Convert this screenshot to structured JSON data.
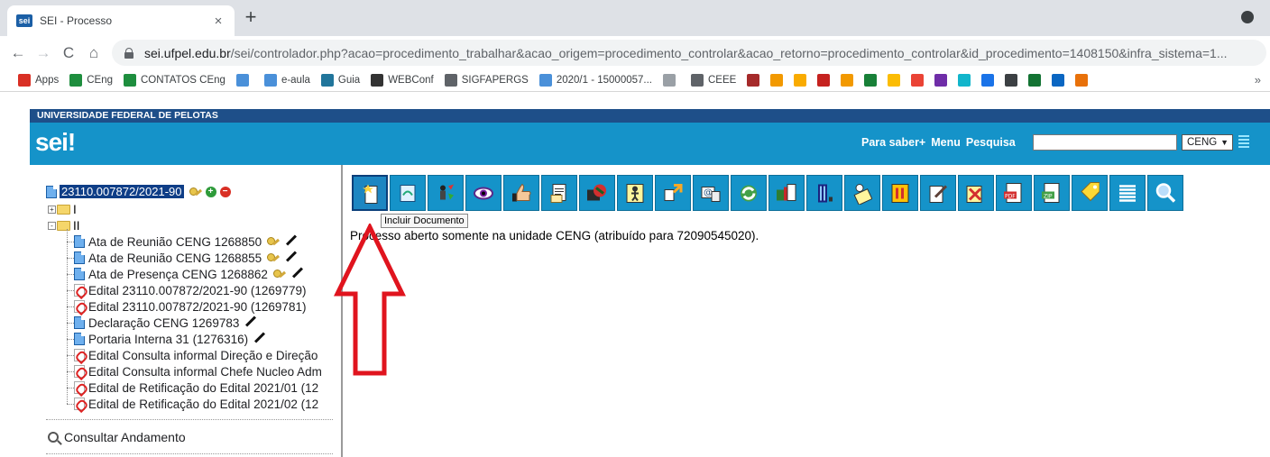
{
  "browser": {
    "tab_title": "SEI - Processo",
    "tab_close": "×",
    "new_tab": "+",
    "url_host": "sei.ufpel.edu.br",
    "url_path": "/sei/controlador.php?acao=procedimento_trabalhar&acao_origem=procedimento_controlar&acao_retorno=procedimento_controlar&id_procedimento=1408150&infra_sistema=1...",
    "nav": {
      "back": "←",
      "forward": "→",
      "reload": "C",
      "home": "⌂"
    },
    "bookmarks": [
      {
        "label": "Apps",
        "icon": "apps-grid-icon",
        "color": "#d93025"
      },
      {
        "label": "CEng",
        "icon": "green-plus-icon",
        "color": "#1e8e3e"
      },
      {
        "label": "CONTATOS CEng",
        "icon": "green-plus-icon",
        "color": "#1e8e3e"
      },
      {
        "label": "",
        "icon": "sei-gear-icon",
        "color": "#4a90d9"
      },
      {
        "label": "e-aula",
        "icon": "sei-gear-icon",
        "color": "#4a90d9"
      },
      {
        "label": "Guia",
        "icon": "wordpress-icon",
        "color": "#21759b"
      },
      {
        "label": "WEBConf",
        "icon": "webconf-icon",
        "color": "#333333"
      },
      {
        "label": "SIGFAPERGS",
        "icon": "globe-icon",
        "color": "#5f6368"
      },
      {
        "label": "2020/1 - 15000057...",
        "icon": "sei-gear-icon",
        "color": "#4a90d9"
      },
      {
        "label": "",
        "icon": "nbr-icon",
        "color": "#9aa0a6"
      },
      {
        "label": "CEEE",
        "icon": "globe-icon",
        "color": "#5f6368"
      }
    ],
    "bookmark_icon_only": [
      "#a52a2a",
      "#f29900",
      "#f9ab00",
      "#c5221f",
      "#f29900",
      "#188038",
      "#fbbc04",
      "#ea4335",
      "#6f2da8",
      "#12b5cb",
      "#1a73e8",
      "#3c4043",
      "#137333",
      "#0a66c2",
      "#e8710a"
    ],
    "bookmarks_more": "»"
  },
  "sei": {
    "org": "UNIVERSIDADE FEDERAL DE PELOTAS",
    "logo": "sei!",
    "menu": {
      "para_saber": "Para saber+",
      "menu": "Menu",
      "pesquisa": "Pesquisa"
    },
    "unit": "CENG",
    "process_number": "23110.007872/2021-90",
    "folders": [
      {
        "label": "I",
        "expander": "+"
      },
      {
        "label": "II",
        "expander": "-"
      }
    ],
    "documents": [
      {
        "label": "Ata de Reunião CENG 1268850",
        "type": "doc",
        "key": true,
        "pen": true
      },
      {
        "label": "Ata de Reunião CENG 1268855",
        "type": "doc",
        "key": true,
        "pen": true
      },
      {
        "label": "Ata de Presença CENG 1268862",
        "type": "doc",
        "key": true,
        "pen": true
      },
      {
        "label": "Edital 23110.007872/2021-90 (1269779)",
        "type": "pdf",
        "key": false,
        "pen": false
      },
      {
        "label": "Edital 23110.007872/2021-90 (1269781)",
        "type": "pdf",
        "key": false,
        "pen": false
      },
      {
        "label": "Declaração CENG 1269783",
        "type": "doc",
        "key": false,
        "pen": true
      },
      {
        "label": "Portaria Interna 31 (1276316)",
        "type": "doc",
        "key": false,
        "pen": true
      },
      {
        "label": "Edital Consulta informal Direção e Direção",
        "type": "pdf",
        "key": false,
        "pen": false
      },
      {
        "label": "Edital Consulta informal Chefe Nucleo Adm",
        "type": "pdf",
        "key": false,
        "pen": false
      },
      {
        "label": "Edital de Retificação do Edital 2021/01 (12",
        "type": "pdf",
        "key": false,
        "pen": false
      },
      {
        "label": "Edital de Retificação do Edital 2021/02 (12",
        "type": "pdf",
        "key": false,
        "pen": false
      }
    ],
    "consultar_andamento": "Consultar Andamento",
    "tooltip": "Incluir Documento",
    "status_message": "Processo aberto somente na unidade CENG (atribuído para 72090545020).",
    "toolbar_icons": [
      "incluir-documento",
      "iniciar-processo-relacionado",
      "atribuir-processo",
      "acompanhamento-especial",
      "ciencia",
      "enviar-email-correspondencia",
      "gerenciar-marcador",
      "gerenciar-disponibilizacoes",
      "enviar-processo",
      "enviar-email",
      "atualizar-andamento",
      "relacionamentos",
      "gerar-bloco",
      "anotacoes",
      "sobrestar-processo",
      "editar-processo",
      "anexar-processo",
      "gerar-pdf",
      "gerar-zip",
      "marcador",
      "lista-documentos",
      "pesquisar-no-processo"
    ]
  }
}
